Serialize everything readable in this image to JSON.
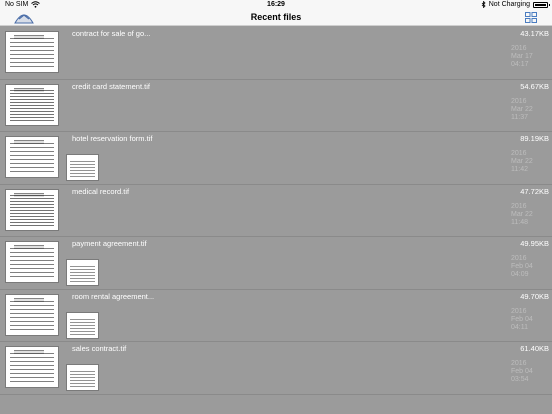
{
  "status_bar": {
    "carrier": "No SIM",
    "time": "16:29",
    "charging": "Not Charging"
  },
  "nav": {
    "title": "Recent files"
  },
  "files": [
    {
      "name": "contract for sale of go...",
      "size": "43.17KB",
      "year": "2016",
      "day": "Mar 17",
      "time": "04:17",
      "attachment": false
    },
    {
      "name": "credit card statement.tif",
      "size": "54.67KB",
      "year": "2016",
      "day": "Mar 22",
      "time": "11:37",
      "attachment": false
    },
    {
      "name": "hotel reservation form.tif",
      "size": "89.19KB",
      "year": "2016",
      "day": "Mar 22",
      "time": "11:42",
      "attachment": true
    },
    {
      "name": "medical record.tif",
      "size": "47.72KB",
      "year": "2016",
      "day": "Mar 22",
      "time": "11:48",
      "attachment": false
    },
    {
      "name": "payment  agreement.tif",
      "size": "49.95KB",
      "year": "2016",
      "day": "Feb 04",
      "time": "04:09",
      "attachment": true
    },
    {
      "name": "room rental agreement...",
      "size": "49.70KB",
      "year": "2016",
      "day": "Feb 04",
      "time": "04:11",
      "attachment": true
    },
    {
      "name": "sales contract.tif",
      "size": "61.40KB",
      "year": "2016",
      "day": "Feb 04",
      "time": "03:54",
      "attachment": true
    }
  ]
}
